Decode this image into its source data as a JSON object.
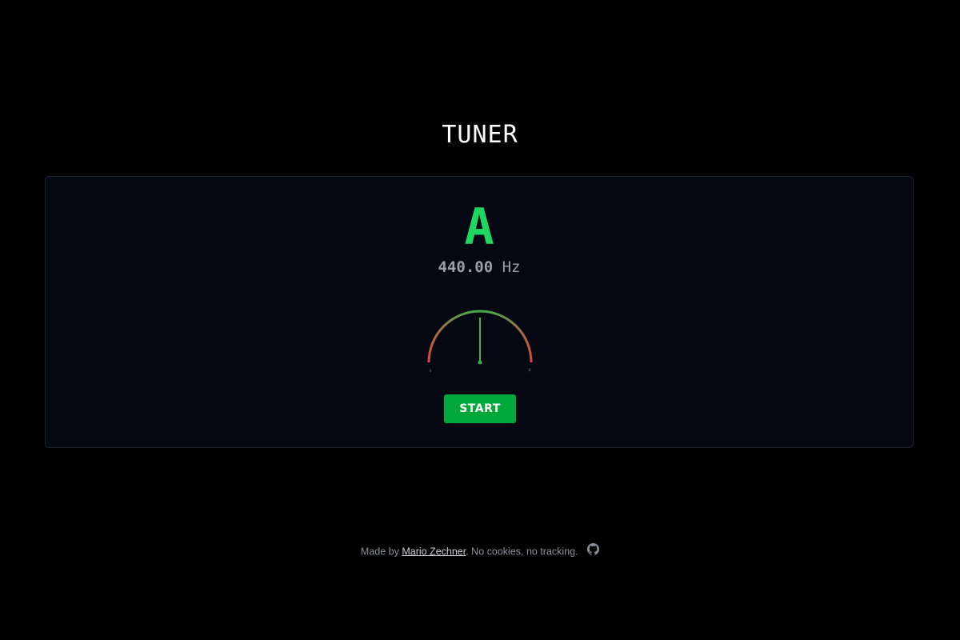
{
  "header": {
    "title": "TUNER"
  },
  "tuner": {
    "note": "A",
    "frequency_value": "440.00",
    "frequency_unit": "Hz",
    "gauge": {
      "flat_symbol": "♭",
      "sharp_symbol": "♯",
      "cents_offset": 0,
      "cents_range": 50
    },
    "start_label": "START"
  },
  "footer": {
    "prefix": "Made by ",
    "author_link": "Mario Zechner",
    "suffix": ". No cookies, no tracking.",
    "github_icon": "github-icon"
  },
  "colors": {
    "note": "#1ed760",
    "button": "#00a83a",
    "gauge_red": "#e0453c",
    "gauge_green": "#3fb04a",
    "needle": "#3fb04a"
  }
}
